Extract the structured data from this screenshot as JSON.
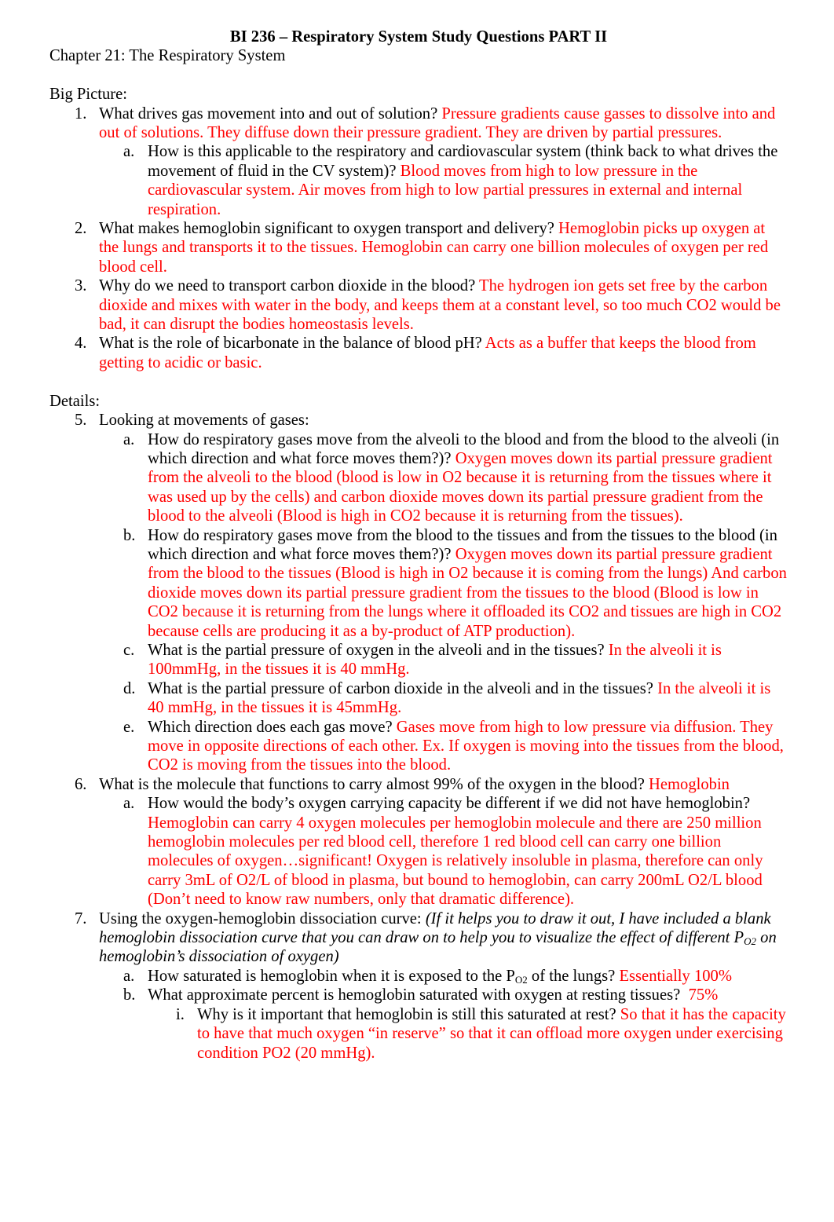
{
  "document": {
    "title": "BI 236 – Respiratory System Study Questions PART II",
    "chapter": "Chapter 21: The Respiratory System",
    "sections": {
      "big_picture": {
        "heading": "Big Picture:",
        "q1": {
          "num": "1.",
          "question": "What drives gas movement into and out of solution?",
          "answer": " Pressure gradients cause gasses to dissolve into and out of solutions. They diffuse down their pressure gradient.  They are driven by partial pressures.",
          "a": {
            "num": "a.",
            "question": "How is this applicable to the respiratory and cardiovascular system (think back to what drives the movement of fluid in the CV system)?",
            "answer": " Blood moves from high to low pressure in the cardiovascular system. Air moves from high to low partial pressures in external and internal respiration."
          }
        },
        "q2": {
          "num": "2.",
          "question": "What makes hemoglobin significant to oxygen transport and delivery?",
          "answer": " Hemoglobin picks up oxygen at the lungs and transports it to the tissues. Hemoglobin can carry one billion molecules of oxygen per red blood cell."
        },
        "q3": {
          "num": "3.",
          "question": "Why do we need to transport carbon dioxide in the blood?",
          "answer": " The hydrogen ion gets set free by the carbon dioxide and mixes with water in the body, and keeps them at a constant level, so too much CO2 would be bad, it can disrupt the bodies homeostasis levels."
        },
        "q4": {
          "num": "4.",
          "question": "What is the role of bicarbonate in the balance of blood pH?",
          "answer": " Acts as a buffer that keeps the blood from getting to acidic or basic."
        }
      },
      "details": {
        "heading": "Details:",
        "q5": {
          "num": "5.",
          "question": "Looking at movements of gases:",
          "a": {
            "num": "a.",
            "question": "How do respiratory gases move from the alveoli to the blood and from the blood to the alveoli (in which direction and what force moves them?)?",
            "answer": " Oxygen moves down its partial pressure gradient from the alveoli to the blood (blood is low in O2 because it is returning from the tissues where it was used up by the cells) and carbon dioxide moves down its partial pressure gradient from the blood to the alveoli (Blood is high in CO2 because it is returning from the tissues)."
          },
          "b": {
            "num": "b.",
            "question": "How do respiratory gases move from the blood to the tissues and from the tissues to the blood (in which direction and what force moves them?)?",
            "answer": " Oxygen moves down its partial pressure gradient from the blood to the tissues (Blood is high in O2 because it is coming from the lungs) And carbon dioxide moves down its partial pressure gradient from the tissues to the blood (Blood is low in CO2 because it is returning from the lungs where it offloaded its CO2 and tissues are high in CO2 because cells are producing it as a by-product of ATP production)."
          },
          "c": {
            "num": "c.",
            "question": "What is the partial pressure of oxygen in the alveoli and in the tissues?",
            "answer": " In the alveoli it is 100mmHg, in the tissues it is 40 mmHg."
          },
          "d": {
            "num": "d.",
            "question": "What is the partial pressure of carbon dioxide in the alveoli and in the tissues?",
            "answer": " In the alveoli it is 40 mmHg, in the tissues it is 45mmHg."
          },
          "e": {
            "num": "e.",
            "question": "Which direction does each gas move?",
            "answer": "  Gases move from high to low pressure via diffusion. They move in opposite directions of each other. Ex. If oxygen is moving into the tissues from the blood, CO2 is moving from the tissues into the blood."
          }
        },
        "q6": {
          "num": "6.",
          "question": "What is the molecule that functions to carry almost 99% of the oxygen in the blood?",
          "answer": " Hemoglobin",
          "a": {
            "num": "a.",
            "question": "How would the body’s oxygen carrying capacity be different if we did not have hemoglobin?",
            "answer": " Hemoglobin can carry 4 oxygen molecules per hemoglobin molecule and there are 250 million hemoglobin molecules per red blood cell, therefore 1 red blood cell can carry one billion molecules of oxygen…significant! Oxygen is relatively insoluble in plasma, therefore can only carry 3mL of O2/L of blood in plasma, but bound to hemoglobin, can carry 200mL O2/L blood (Don’t need to know raw numbers, only that dramatic difference)."
          }
        },
        "q7": {
          "num": "7.",
          "question": "Using the oxygen-hemoglobin dissociation curve: ",
          "note_part1": "(If it helps you to draw it out, I have included a blank hemoglobin dissociation curve that you can draw on to help you to visualize the effect of different P",
          "note_sub": "O2",
          "note_part2": " on hemoglobin’s dissociation of oxygen)",
          "a": {
            "num": "a.",
            "question_part1": "How saturated is hemoglobin when it is exposed to the P",
            "question_sub": "O2",
            "question_part2": " of the lungs?",
            "answer": " Essentially 100%"
          },
          "b": {
            "num": "b.",
            "question": "What approximate percent is hemoglobin saturated with oxygen at resting tissues?",
            "answer": "  75%",
            "i": {
              "num": "i.",
              "question": "Why is it important that hemoglobin is still this saturated at rest?",
              "answer": "  So that it has the capacity to have that much oxygen “in reserve” so that it can offload more oxygen under exercising condition PO2 (20 mmHg)."
            }
          }
        }
      }
    }
  },
  "colors": {
    "question_text": "#000000",
    "answer_text": "#ff0000",
    "background": "#ffffff"
  }
}
